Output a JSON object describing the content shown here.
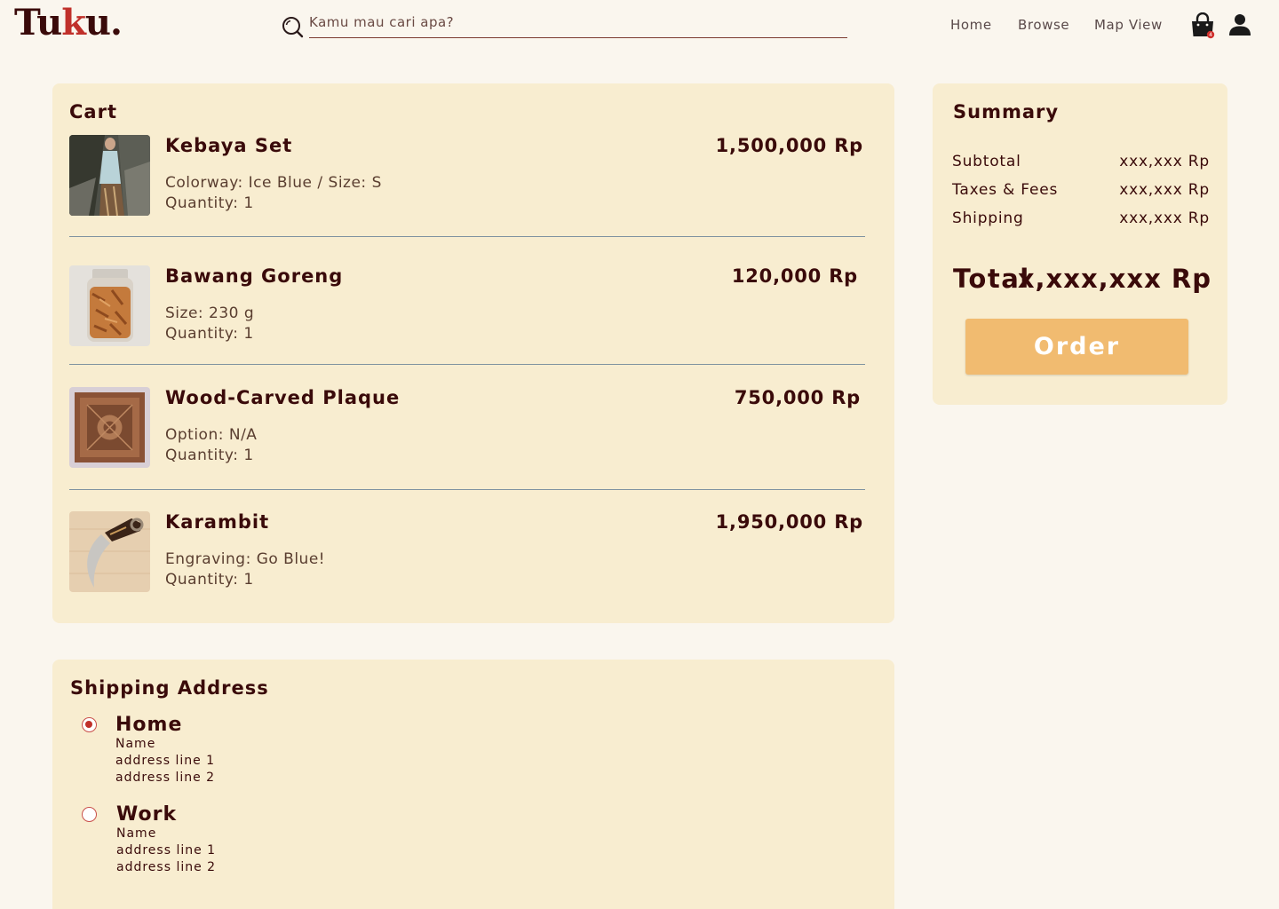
{
  "header": {
    "logo_prefix": "Tu",
    "logo_k": "k",
    "logo_suffix": "u.",
    "search_placeholder": "Kamu mau cari apa?",
    "nav": [
      "Home",
      "Browse",
      "Map View"
    ],
    "cart_badge": "4"
  },
  "cart": {
    "title": "Cart",
    "items": [
      {
        "name": "Kebaya Set",
        "price": "1,500,000 Rp",
        "option": "Colorway: Ice Blue / Size: S",
        "quantity": "Quantity: 1"
      },
      {
        "name": "Bawang Goreng",
        "price": "120,000 Rp",
        "option": "Size: 230 g",
        "quantity": "Quantity: 1"
      },
      {
        "name": "Wood-Carved Plaque",
        "price": "750,000 Rp",
        "option": "Option: N/A",
        "quantity": "Quantity: 1"
      },
      {
        "name": "Karambit",
        "price": "1,950,000 Rp",
        "option": "Engraving: Go Blue!",
        "quantity": "Quantity: 1"
      }
    ]
  },
  "summary": {
    "title": "Summary",
    "rows": [
      {
        "label": "Subtotal",
        "value": "xxx,xxx Rp"
      },
      {
        "label": "Taxes & Fees",
        "value": "xxx,xxx Rp"
      },
      {
        "label": "Shipping",
        "value": "xxx,xxx Rp"
      }
    ],
    "total_label": "Total",
    "total_value": "x,xxx,xxx Rp",
    "order_label": "Order"
  },
  "shipping": {
    "title": "Shipping Address",
    "addresses": [
      {
        "title": "Home",
        "name": "Name",
        "line1": "address line 1",
        "line2": "address line 2",
        "selected": true
      },
      {
        "title": "Work",
        "name": "Name",
        "line1": "address line 1",
        "line2": "address line 2",
        "selected": false
      }
    ]
  },
  "colors": {
    "background": "#faf6ee",
    "card": "#f8edd0",
    "accent": "#f1bb70",
    "text": "#3a0a0a",
    "brand_red": "#c0302a"
  }
}
